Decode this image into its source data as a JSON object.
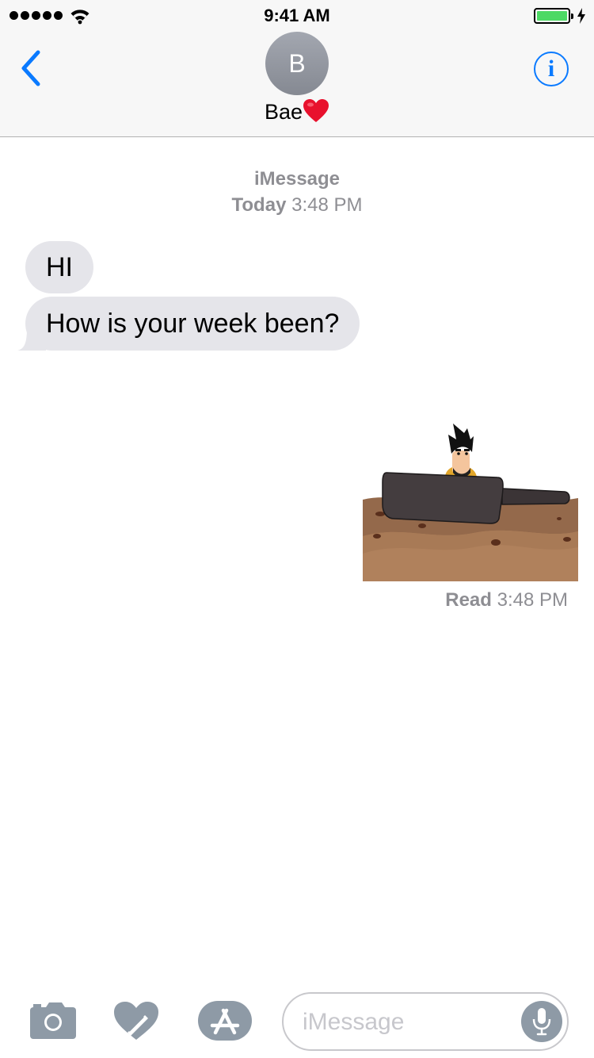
{
  "status": {
    "time": "9:41 AM",
    "signal_bars": 5,
    "battery_percent": 100,
    "charging": true
  },
  "nav": {
    "back_icon": "chevron-left-icon",
    "avatar_initial": "B",
    "contact_name": "Bae",
    "contact_emoji": "heart-icon",
    "info_label": "i"
  },
  "conversation": {
    "service": "iMessage",
    "day": "Today",
    "time": "3:48 PM",
    "incoming": [
      {
        "text": "HI"
      },
      {
        "text": "How is your week been?"
      }
    ],
    "outgoing_sticker": "frying-pan-boat-sticker",
    "receipt_label": "Read",
    "receipt_time": "3:48 PM"
  },
  "input_bar": {
    "camera_icon": "camera-icon",
    "digital_touch_icon": "digital-touch-heart-icon",
    "apps_icon": "app-store-icon",
    "placeholder": "iMessage",
    "mic_icon": "microphone-icon"
  },
  "colors": {
    "accent": "#0a7aff",
    "bubble_incoming": "#e5e5ea",
    "meta_text": "#8e8e93",
    "battery": "#4cd964"
  }
}
